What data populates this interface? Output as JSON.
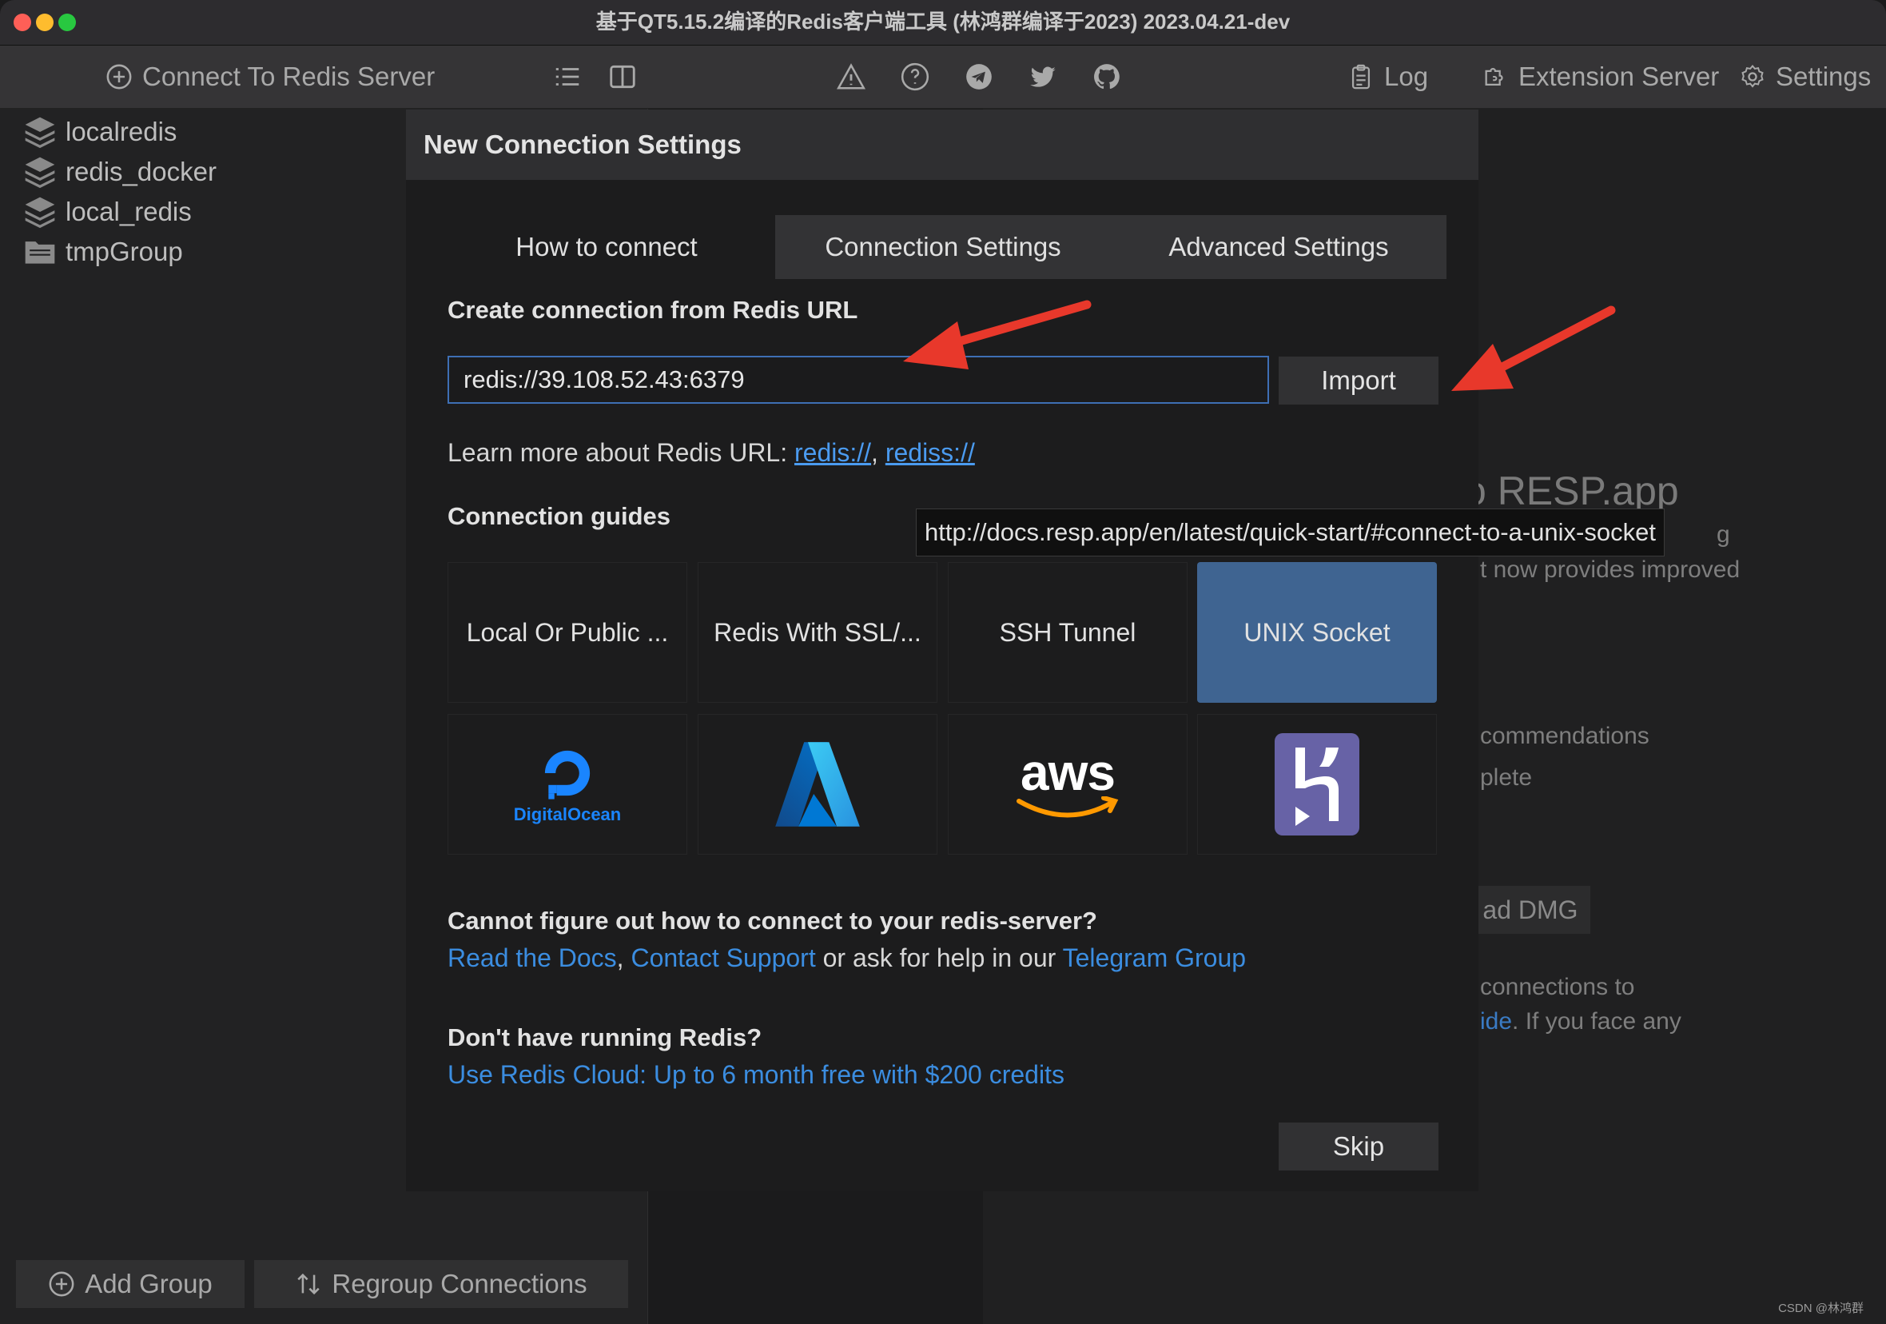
{
  "window": {
    "title": "基于QT5.15.2编译的Redis客户端工具 (林鸿群编译于2023) 2023.04.21-dev"
  },
  "toolbar": {
    "connect_label": "Connect To Redis Server",
    "log_label": "Log",
    "extension_label": "Extension Server",
    "settings_label": "Settings"
  },
  "sidebar": {
    "items": [
      {
        "label": "localredis",
        "icon": "database-stack-icon"
      },
      {
        "label": "redis_docker",
        "icon": "database-stack-icon"
      },
      {
        "label": "local_redis",
        "icon": "database-stack-icon"
      },
      {
        "label": "tmpGroup",
        "icon": "folder-icon"
      }
    ],
    "add_group_label": "Add Group",
    "regroup_label": "Regroup Connections"
  },
  "background": {
    "heading_partial": "o RESP.app",
    "g": "g",
    "line1": "t now provides improved",
    "line2": "commendations",
    "line3": "plete",
    "dmg_button": "ad DMG",
    "line4": "connections to",
    "line5_link": "ide",
    "line5_rest": ". If you face any"
  },
  "dialog": {
    "title": "New Connection Settings",
    "tabs": [
      "How to connect",
      "Connection Settings",
      "Advanced Settings"
    ],
    "url_section_label": "Create connection from Redis URL",
    "url_value": "redis://39.108.52.43:6379",
    "import_label": "Import",
    "learn_more_prefix": "Learn more about Redis URL: ",
    "learn_link_1": "redis://",
    "learn_sep": ", ",
    "learn_link_2": "rediss://",
    "guides_label": "Connection guides",
    "tooltip": "http://docs.resp.app/en/latest/quick-start/#connect-to-a-unix-socket",
    "guides": [
      "Local Or Public ...",
      "Redis With SSL/...",
      "SSH Tunnel",
      "UNIX Socket"
    ],
    "providers": {
      "digitalocean_text": "DigitalOcean",
      "aws_text": "aws"
    },
    "help_heading": "Cannot figure out how to connect to your redis-server?",
    "help_link_docs": "Read the Docs",
    "help_sep": ", ",
    "help_link_support": "Contact Support",
    "help_mid": " or ask for help in our ",
    "help_link_telegram": "Telegram Group",
    "cloud_heading": "Don't have running Redis?",
    "cloud_link": "Use Redis Cloud: Up to 6 month free with $200 credits",
    "skip_label": "Skip"
  },
  "watermark": "CSDN @林鸿群",
  "colors": {
    "accent": "#3b8de0",
    "selected_tile": "#3f6491",
    "arrow": "#e8382b"
  }
}
